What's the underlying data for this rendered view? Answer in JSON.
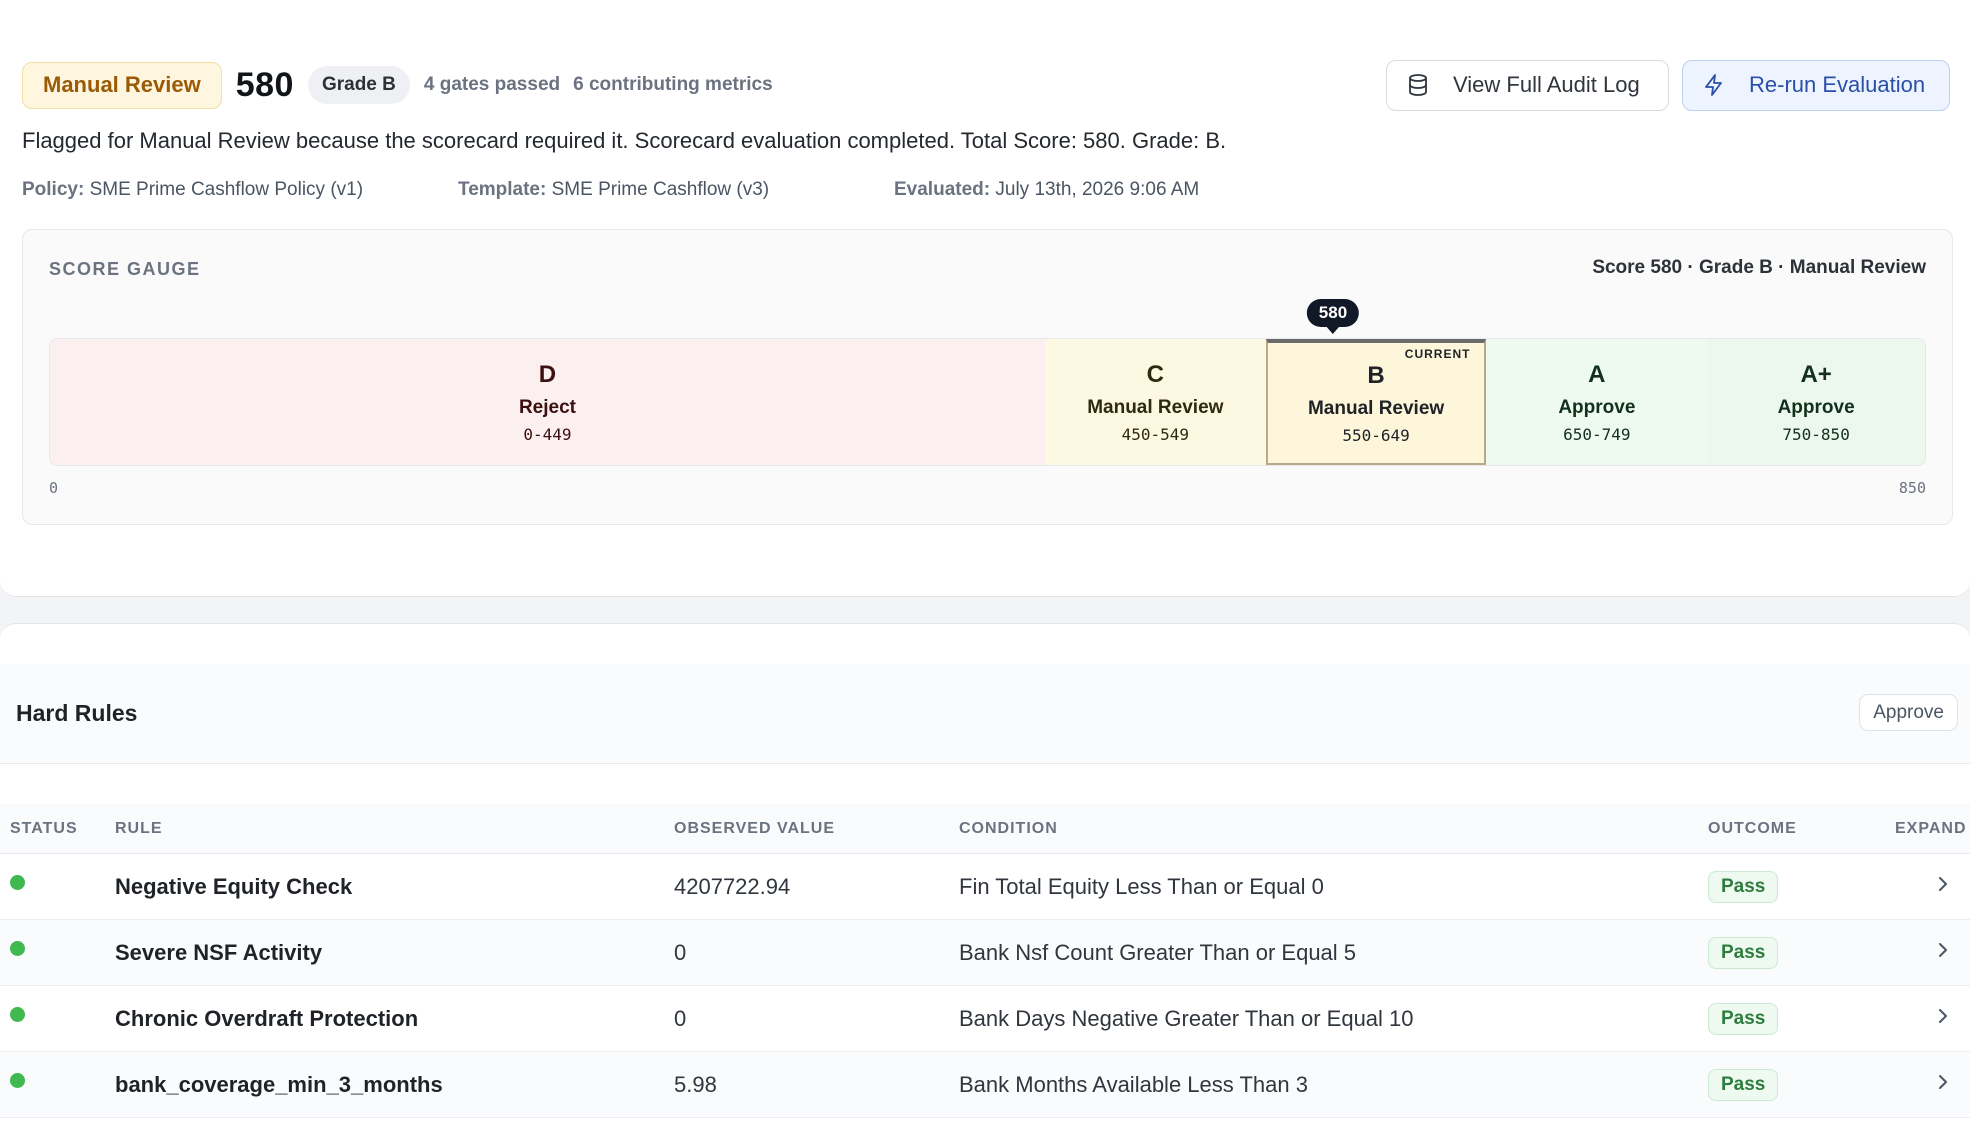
{
  "header": {
    "decision": "Manual Review",
    "score": "580",
    "grade": "Grade B",
    "gates_passed": "4 gates passed",
    "contributing_metrics": "6 contributing metrics",
    "audit_button": "View Full Audit Log",
    "rerun_button": "Re-run Evaluation"
  },
  "summary": "Flagged for Manual Review because the scorecard required it. Scorecard evaluation completed. Total Score: 580. Grade: B.",
  "meta": {
    "policy_label": "Policy:",
    "policy_value": "SME Prime Cashflow Policy (v1)",
    "template_label": "Template:",
    "template_value": "SME Prime Cashflow (v3)",
    "evaluated_label": "Evaluated:",
    "evaluated_value": "July 13th, 2026 9:06 AM"
  },
  "gauge": {
    "title": "SCORE GAUGE",
    "summary": "Score 580 · Grade B · Manual Review",
    "marker": "580",
    "score_value": 580,
    "min": "0",
    "max": "850",
    "min_value": 0,
    "max_value": 850,
    "current_tag": "CURRENT",
    "bands": [
      {
        "letter": "D",
        "label": "Reject",
        "range": "0-449",
        "from": 0,
        "to": 449,
        "bg": "#fcefef",
        "fg": "#3b1010"
      },
      {
        "letter": "C",
        "label": "Manual Review",
        "range": "450-549",
        "from": 450,
        "to": 549,
        "bg": "#fdf8e1",
        "fg": "#2e2a10"
      },
      {
        "letter": "B",
        "label": "Manual Review",
        "range": "550-649",
        "from": 550,
        "to": 649,
        "bg": "#fdf6da",
        "fg": "#1f2328",
        "current": true
      },
      {
        "letter": "A",
        "label": "Approve",
        "range": "650-749",
        "from": 650,
        "to": 749,
        "bg": "#eef9f0",
        "fg": "#12301a"
      },
      {
        "letter": "A+",
        "label": "Approve",
        "range": "750-850",
        "from": 750,
        "to": 850,
        "bg": "#ecf8ee",
        "fg": "#12301a"
      }
    ]
  },
  "hard_rules": {
    "title": "Hard Rules",
    "tag": "Approve",
    "columns": {
      "status": "STATUS",
      "rule": "RULE",
      "observed": "OBSERVED VALUE",
      "condition": "CONDITION",
      "outcome": "OUTCOME",
      "expand": "EXPAND"
    },
    "rows": [
      {
        "rule": "Negative Equity Check",
        "observed": "4207722.94",
        "condition": "Fin Total Equity Less Than or Equal 0",
        "outcome": "Pass"
      },
      {
        "rule": "Severe NSF Activity",
        "observed": "0",
        "condition": "Bank Nsf Count Greater Than or Equal 5",
        "outcome": "Pass"
      },
      {
        "rule": "Chronic Overdraft Protection",
        "observed": "0",
        "condition": "Bank Days Negative Greater Than or Equal 10",
        "outcome": "Pass"
      },
      {
        "rule": "bank_coverage_min_3_months",
        "observed": "5.98",
        "condition": "Bank Months Available Less Than 3",
        "outcome": "Pass"
      }
    ]
  },
  "colors": {
    "status_pass": "#3fb950",
    "accent": "#2a4fa6",
    "decision": "#9a5a06"
  }
}
